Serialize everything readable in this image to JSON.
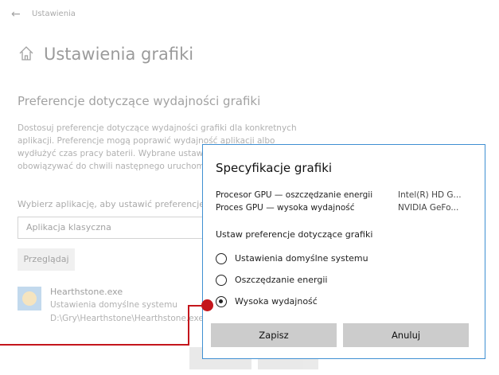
{
  "window": {
    "title": "Ustawienia"
  },
  "page": {
    "title": "Ustawienia grafiki",
    "section_title": "Preferencje dotyczące wydajności grafiki",
    "description": "Dostosuj preferencje dotyczące wydajności grafiki dla konkretnych aplikacji. Preferencje mogą poprawić wydajność aplikacji albo wydłużyć czas pracy baterii. Wybrane ustawienia zaczną obowiązywać do chwili następnego uruchomienia aplikacji.",
    "selector_label": "Wybierz aplikację, aby ustawić preferencje",
    "app_type_value": "Aplikacja klasyczna",
    "browse_label": "Przeglądaj",
    "app": {
      "name": "Hearthstone.exe",
      "setting": "Ustawienia domyślne systemu",
      "path": "D:\\Gry\\Hearthstone\\Hearthstone.exe"
    }
  },
  "dialog": {
    "title": "Specyfikacje grafiki",
    "gpu_rows": [
      {
        "label": "Procesor GPU — oszczędzanie energii",
        "value": "Intel(R) HD G..."
      },
      {
        "label": "Proces GPU — wysoka wydajność",
        "value": "NVIDIA GeFo..."
      }
    ],
    "pref_label": "Ustaw preferencje dotyczące grafiki",
    "options": [
      {
        "label": "Ustawienia domyślne systemu",
        "selected": false
      },
      {
        "label": "Oszczędzanie energii",
        "selected": false
      },
      {
        "label": "Wysoka wydajność",
        "selected": true
      }
    ],
    "save_label": "Zapisz",
    "cancel_label": "Anuluj"
  },
  "colors": {
    "dialog_border": "#3f8fd2",
    "callout": "#c4161c",
    "button_bg": "#cccccc"
  }
}
